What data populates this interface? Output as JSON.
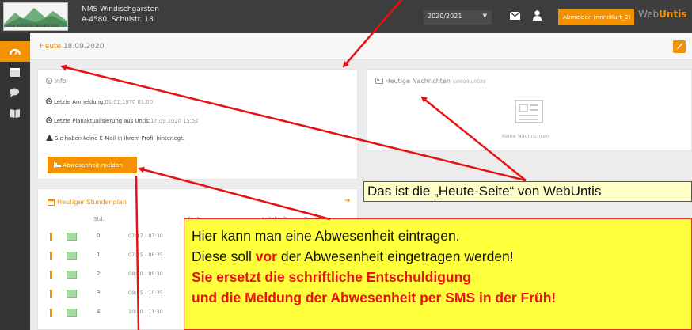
{
  "header": {
    "school_name": "NMS Windischgarsten",
    "school_address": "A-4580, Schulstr. 18",
    "logo_text": "NMS WINDISCHGARSTEN",
    "school_year": "2020/2021",
    "logout_label": "Abmelden (nnnnKurt_2)",
    "brand_web": "Web",
    "brand_untis": "Untis"
  },
  "page": {
    "today_label": "Heute",
    "today_date": "18.09.2020"
  },
  "info": {
    "title": "Info",
    "last_login_label": "Letzte Anmeldung:",
    "last_login_value": "01.01.1970 01:00",
    "last_update_label": "Letzte Planaktualisierung aus Untis:",
    "last_update_value": "17.09.2020 15:52",
    "warning": "Sie haben keine E-Mail in ihrem Profil hinterlegt.",
    "absence_button": "Abwesenheit melden"
  },
  "news": {
    "title": "Heutige Nachrichten",
    "empty": "Keine Nachrichten"
  },
  "timetable": {
    "title": "Heutiger Stundenplan",
    "columns": [
      "Std.",
      "Fach",
      "Lehrkraft",
      "Raum"
    ],
    "rows": [
      {
        "std": "0",
        "time": "07:17 - 07:30"
      },
      {
        "std": "1",
        "time": "07:45 - 08:35"
      },
      {
        "std": "2",
        "time": "08:40 - 09:30"
      },
      {
        "std": "3",
        "time": "09:45 - 10:35"
      },
      {
        "std": "4",
        "time": "10:40 - 11:30"
      }
    ]
  },
  "annotations": {
    "callout_top": "Das ist die „Heute-Seite“ von WebUntis",
    "line1": "Hier kann man eine Abwesenheit eintragen.",
    "line2_pre": "Diese soll ",
    "line2_red": "vor",
    "line2_post": " der Abwesenheit eingetragen werden!",
    "line3": "Sie ersetzt die schriftliche Entschuldigung",
    "line4": "und die Meldung der Abwesenheit per SMS in der Früh!"
  },
  "colors": {
    "accent": "#f49100",
    "topbar": "#3d3d3d",
    "sidebar": "#333333",
    "arrow": "#e81010"
  }
}
